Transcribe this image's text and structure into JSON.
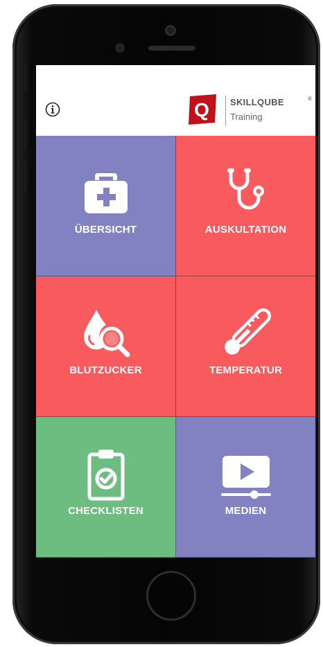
{
  "header": {
    "info_icon": "info-icon",
    "brand": {
      "logo_letter": "Q",
      "name": "SKILLQUBE",
      "registered": "®",
      "subtitle": "Training",
      "color": "#c0121b"
    }
  },
  "tiles": [
    {
      "label": "ÜBERSICHT",
      "icon": "first-aid-kit-icon",
      "color": "#8282c2"
    },
    {
      "label": "AUSKULTATION",
      "icon": "stethoscope-icon",
      "color": "#f85a5d"
    },
    {
      "label": "BLUTZUCKER",
      "icon": "blood-drop-magnifier-icon",
      "color": "#f85a5d"
    },
    {
      "label": "TEMPERATUR",
      "icon": "thermometer-icon",
      "color": "#f85a5d"
    },
    {
      "label": "CHECKLISTEN",
      "icon": "clipboard-check-icon",
      "color": "#6cbd7f"
    },
    {
      "label": "MEDIEN",
      "icon": "video-player-icon",
      "color": "#8282c2"
    }
  ]
}
